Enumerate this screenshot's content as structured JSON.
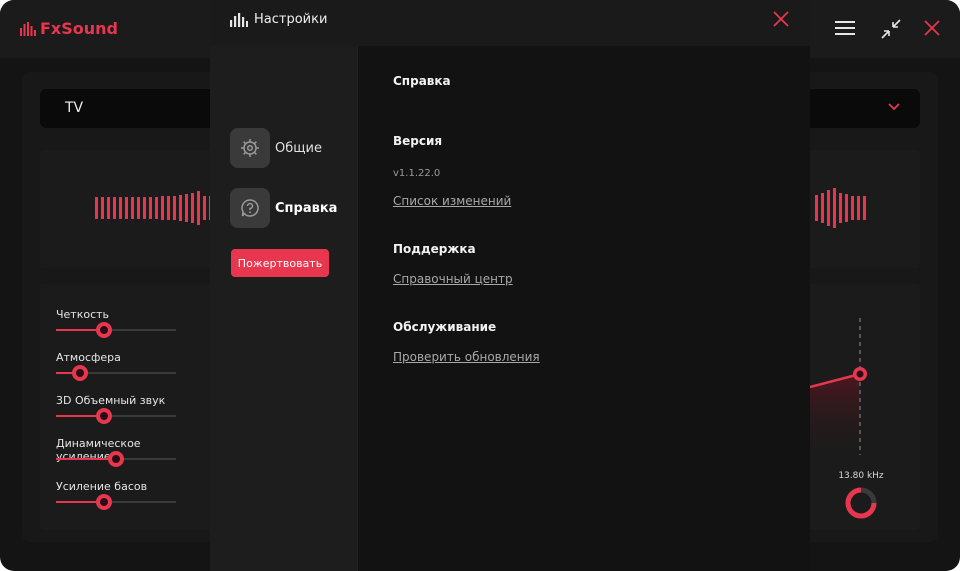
{
  "app": {
    "logo_text": "FxSound",
    "preset_value": "TV",
    "accent_color": "#e8364f"
  },
  "effects": [
    {
      "label": "Четкость",
      "value": 0.4
    },
    {
      "label": "Атмосфера",
      "value": 0.2
    },
    {
      "label": "3D Объемный звук",
      "value": 0.4
    },
    {
      "label": "Динамическое усиление",
      "value": 0.5
    },
    {
      "label": "Усиление басов",
      "value": 0.4
    }
  ],
  "eq": {
    "frequency_label": "13.80 kHz"
  },
  "settings": {
    "title": "Настройки",
    "nav": [
      {
        "label": "Общие",
        "icon": "gear-icon"
      },
      {
        "label": "Справка",
        "icon": "help-icon"
      }
    ],
    "donate_label": "Пожертвовать",
    "content": {
      "section_title": "Справка",
      "version_heading": "Версия",
      "version_value": "v1.1.22.0",
      "changelog_link": "Список изменений",
      "support_heading": "Поддержка",
      "help_center_link": "Справочный центр",
      "maintenance_heading": "Обслуживание",
      "check_updates_link": "Проверить обновления"
    }
  }
}
